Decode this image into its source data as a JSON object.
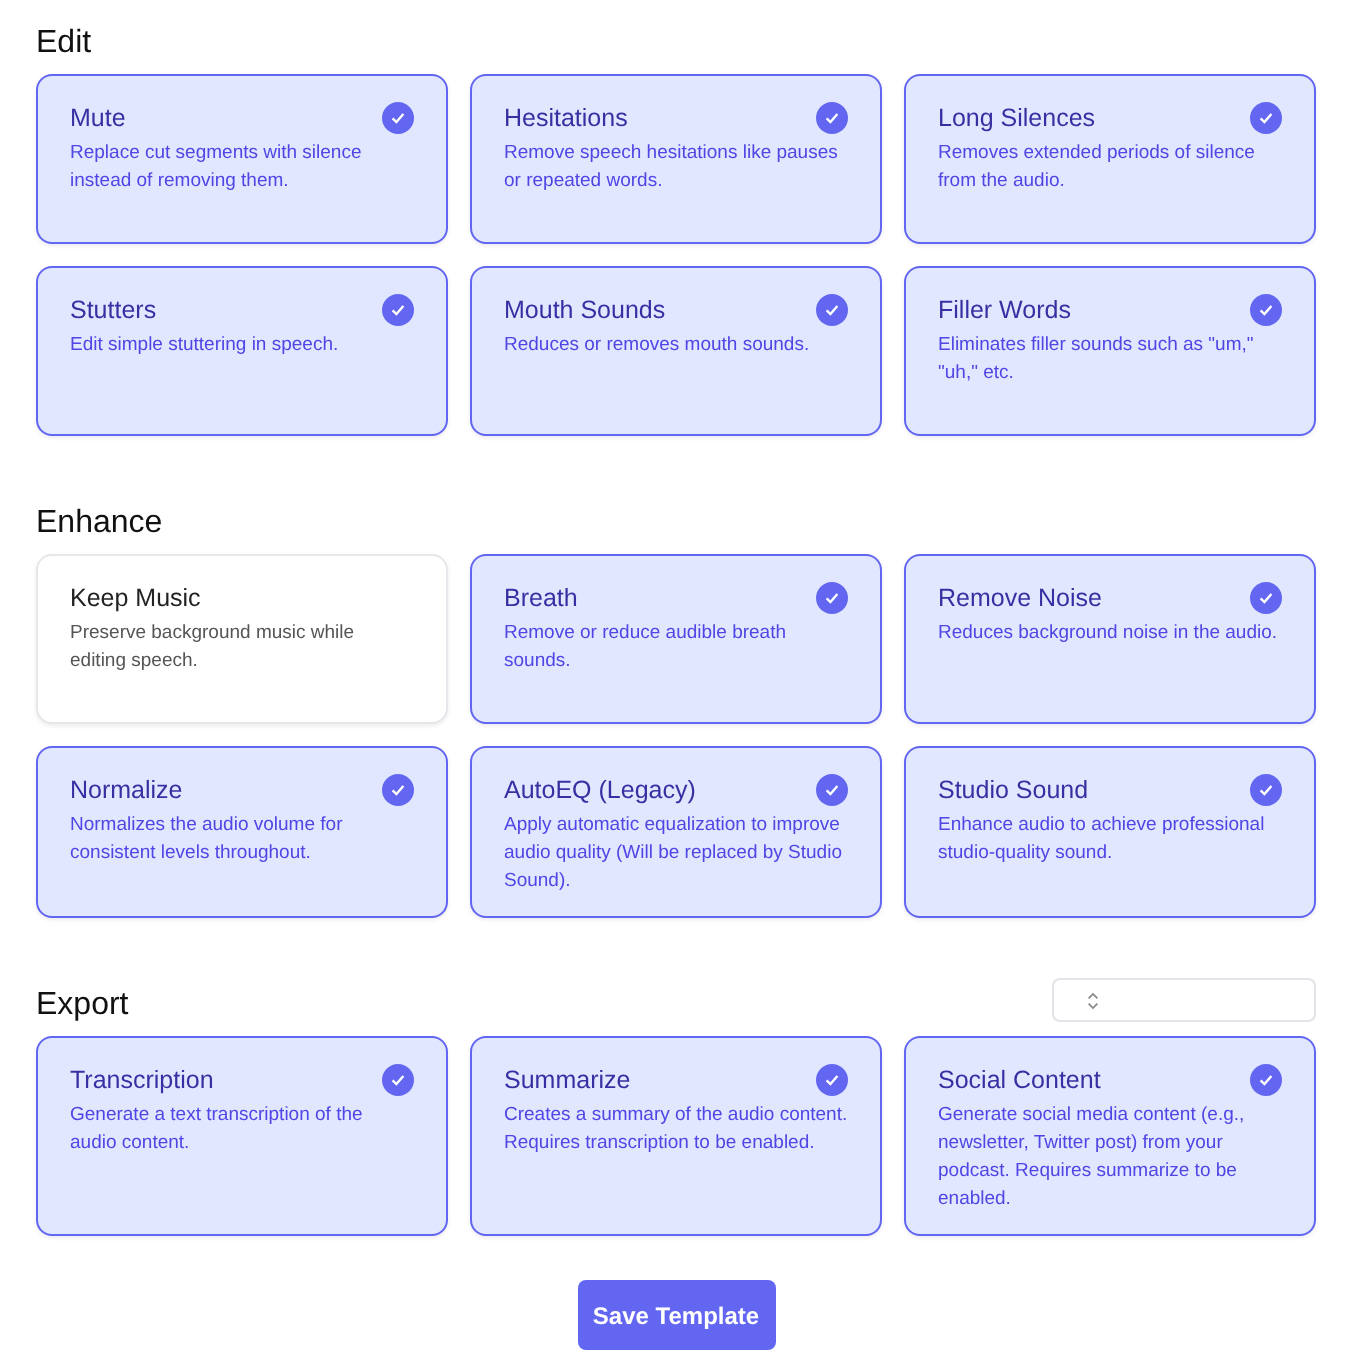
{
  "sections": [
    {
      "title": "Edit",
      "options": [
        {
          "title": "Mute",
          "description": "Replace cut segments with silence instead of removing them.",
          "selected": true
        },
        {
          "title": "Hesitations",
          "description": "Remove speech hesitations like pauses or repeated words.",
          "selected": true
        },
        {
          "title": "Long Silences",
          "description": "Removes extended periods of silence from the audio.",
          "selected": true
        },
        {
          "title": "Stutters",
          "description": "Edit simple stuttering in speech.",
          "selected": true
        },
        {
          "title": "Mouth Sounds",
          "description": "Reduces or removes mouth sounds.",
          "selected": true
        },
        {
          "title": "Filler Words",
          "description": "Eliminates filler sounds such as \"um,\" \"uh,\" etc.",
          "selected": true
        }
      ]
    },
    {
      "title": "Enhance",
      "options": [
        {
          "title": "Keep Music",
          "description": "Preserve background music while editing speech.",
          "selected": false
        },
        {
          "title": "Breath",
          "description": "Remove or reduce audible breath sounds.",
          "selected": true
        },
        {
          "title": "Remove Noise",
          "description": "Reduces background noise in the audio.",
          "selected": true
        },
        {
          "title": "Normalize",
          "description": "Normalizes the audio volume for consistent levels throughout.",
          "selected": true
        },
        {
          "title": "AutoEQ (Legacy)",
          "description": "Apply automatic equalization to improve audio quality (Will be replaced by Studio Sound).",
          "selected": true
        },
        {
          "title": "Studio Sound",
          "description": "Enhance audio to achieve professional studio-quality sound.",
          "selected": true
        }
      ]
    },
    {
      "title": "Export",
      "select": {
        "kind": "dropdown"
      },
      "options": [
        {
          "title": "Transcription",
          "description": "Generate a text transcription of the audio content.",
          "selected": true
        },
        {
          "title": "Summarize",
          "description": "Creates a summary of the audio content. Requires transcription to be enabled.",
          "selected": true
        },
        {
          "title": "Social Content",
          "description": "Generate social media content (e.g., newsletter, Twitter post) from your podcast. Requires summarize to be enabled.",
          "selected": true
        }
      ]
    }
  ],
  "save_button": "Save Template"
}
